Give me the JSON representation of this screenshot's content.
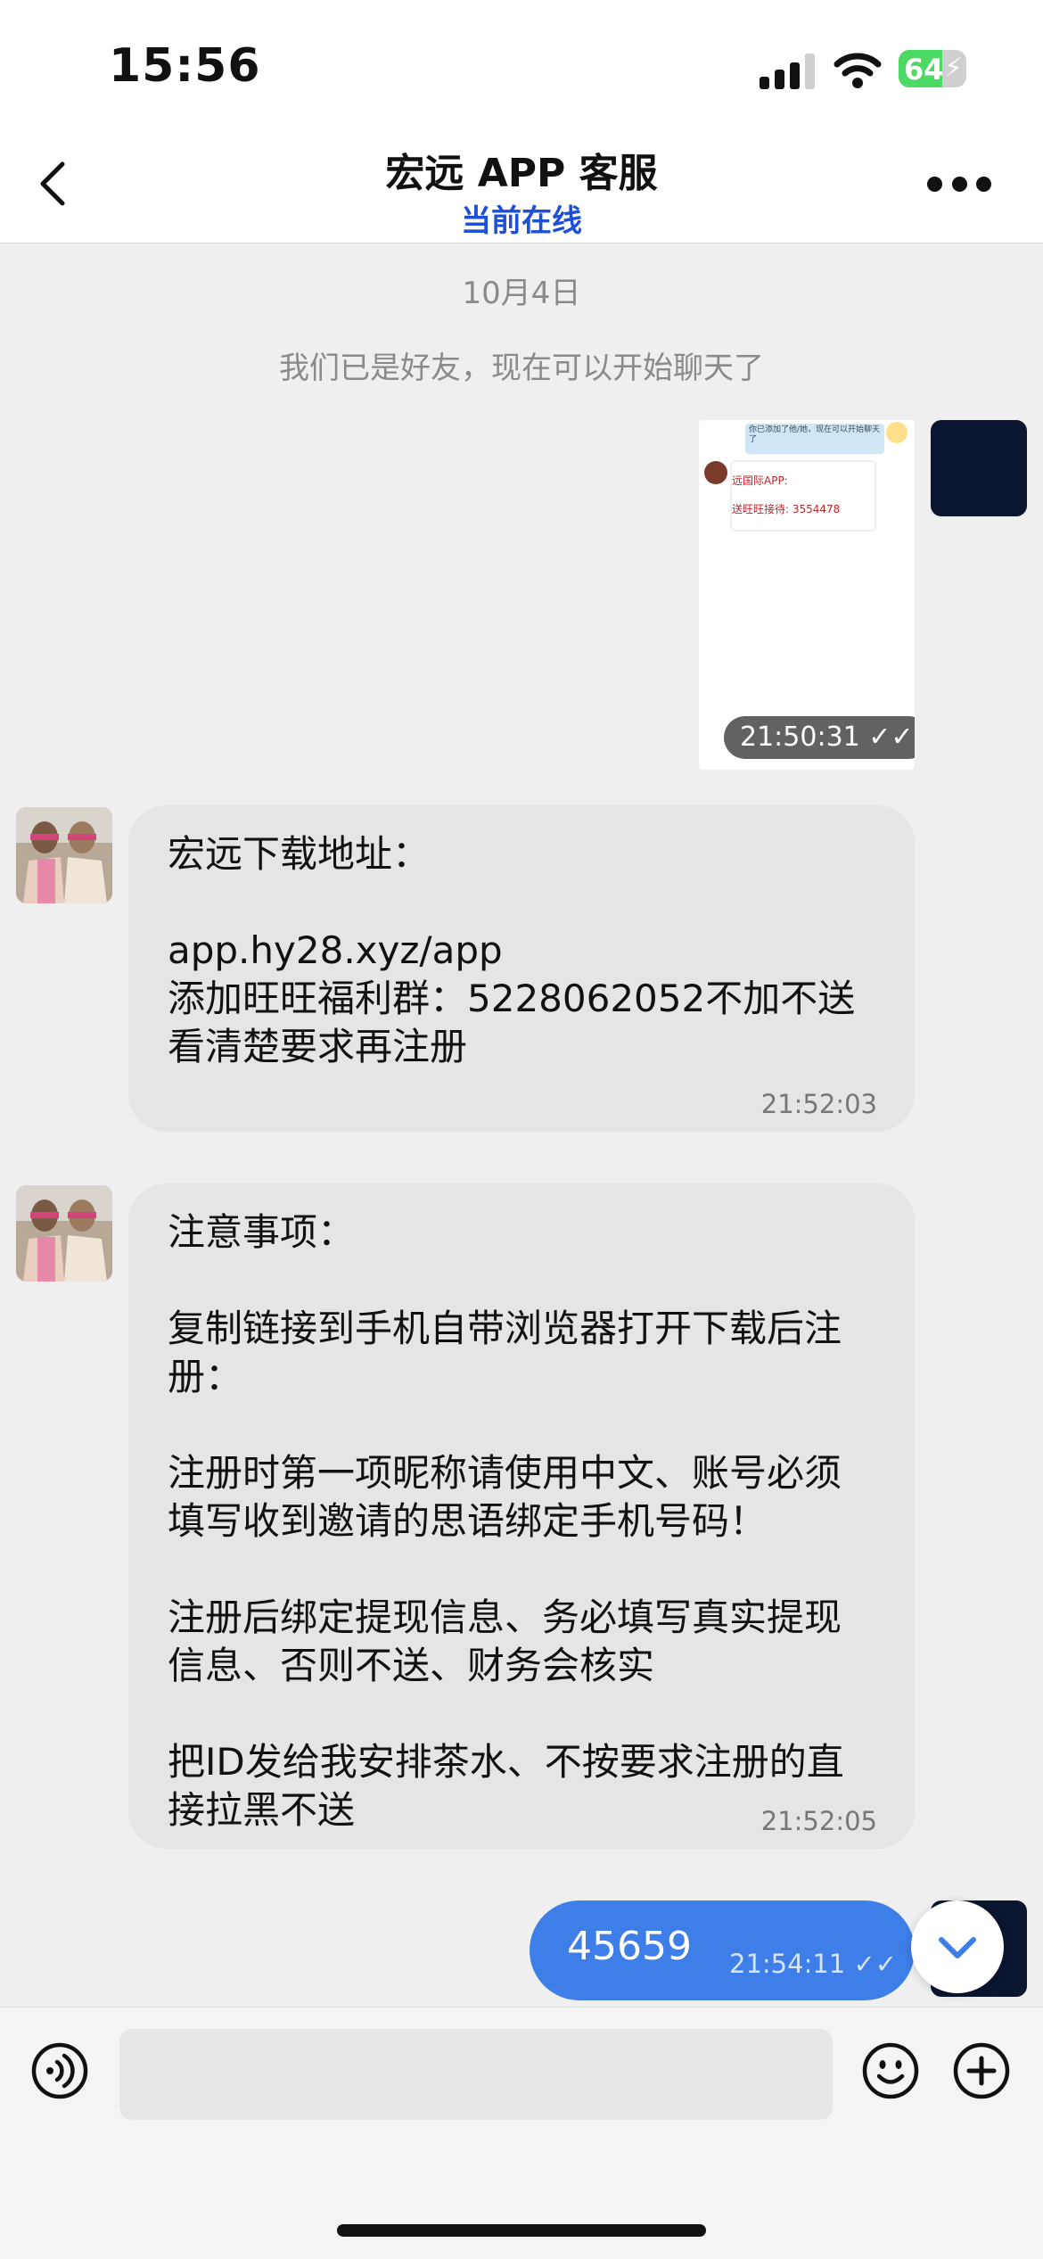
{
  "status_bar": {
    "time": "15:56",
    "battery": "64",
    "battery_level": 0.64
  },
  "header": {
    "title": "宏远 APP 客服",
    "subtitle": "当前在线"
  },
  "chat": {
    "date": "10月4日",
    "system_message": "我们已是好友，现在可以开始聊天了",
    "image_message": {
      "time": "21:50:31 ✓✓",
      "thumb_bubble": "你已添加了他/她，现在可以开始聊天了",
      "thumb_line1": "远国际APP:",
      "thumb_line2": "送旺旺接待: 3554478"
    },
    "messages": [
      {
        "text": "宏远下载地址：\n\napp.hy28.xyz/app\n添加旺旺福利群：5228062052不加不送\n看清楚要求再注册",
        "time": "21:52:03"
      },
      {
        "text": "注意事项：\n\n复制链接到手机自带浏览器打开下载后注册：\n\n注册时第一项昵称请使用中文、账号必须填写收到邀请的思语绑定手机号码！\n\n注册后绑定提现信息、务必填写真实提现信息、否则不送、财务会核实\n\n把ID发给我安排茶水、不按要求注册的直接拉黑不送",
        "time": "21:52:05"
      }
    ],
    "outgoing": {
      "text": "45659",
      "time": "21:54:11 ✓✓"
    }
  },
  "input": {
    "placeholder": ""
  },
  "icons": [
    "back-chevron-icon",
    "more-dots-icon",
    "voice-icon",
    "emoji-icon",
    "plus-icon",
    "chevron-down-icon"
  ],
  "colors": {
    "accent": "#3e7ee8",
    "online": "#1e4fd8"
  }
}
